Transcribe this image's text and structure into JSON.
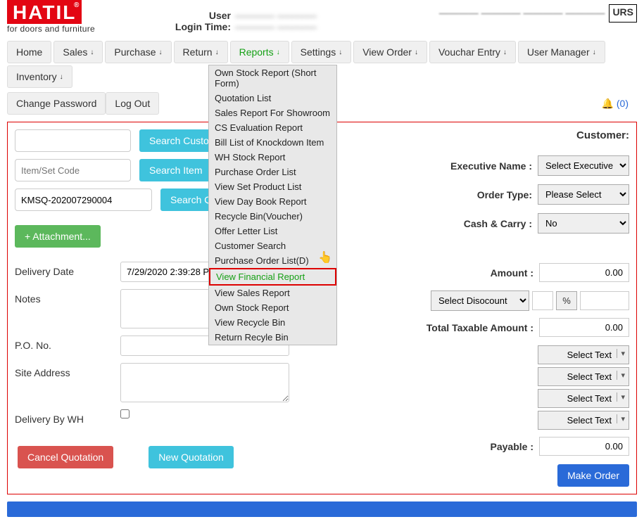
{
  "logo": {
    "brand": "HATIL",
    "tagline": "for doors and furniture"
  },
  "header": {
    "user_label": "User",
    "login_label": "Login Time:",
    "user_val": "———— ————",
    "login_val": "———— ————",
    "script": "———— ———— ———— ————",
    "urs": "URS"
  },
  "nav": {
    "home": "Home",
    "sales": "Sales",
    "purchase": "Purchase",
    "return": "Return",
    "reports": "Reports",
    "settings": "Settings",
    "view_order": "View Order",
    "voucher": "Vouchar Entry",
    "user_mgr": "User Manager",
    "inventory": "Inventory",
    "change_pw": "Change Password",
    "logout": "Log Out",
    "notif_count": "(0)"
  },
  "dropdown": [
    "Own Stock Report (Short Form)",
    "Quotation List",
    "Sales Report For Showroom",
    "CS Evaluation Report",
    "Bill List of Knockdown Item",
    "WH Stock Report",
    "Purchase Order List",
    "View Set Product List",
    "View Day Book Report",
    "Recycle Bin(Voucher)",
    "Offer Letter List",
    "Customer Search",
    "Purchase Order List(D)",
    "View Financial Report",
    "View Sales Report",
    "Own Stock Report",
    "View Recycle Bin",
    "Return Recyle Bin"
  ],
  "highlighted_index": 13,
  "search": {
    "placeholder_itemset": "Item/Set Code",
    "quotation_value": "KMSQ-202007290004",
    "btn_customer": "Search Customer",
    "btn_item": "Search Item",
    "btn_quotation": "Search Quotation"
  },
  "buttons": {
    "attachment": "+  Attachment...",
    "cancel": "Cancel Quotation",
    "new": "New Quotation",
    "make": "Make Order"
  },
  "form": {
    "delivery_date_label": "Delivery Date",
    "delivery_date_value": "7/29/2020 2:39:28 PM",
    "notes_label": "Notes",
    "po_label": "P.O. No.",
    "site_label": "Site Address",
    "delivery_wh_label": "Delivery By WH"
  },
  "right": {
    "customer_title": "Customer:",
    "exec_label": "Executive Name :",
    "exec_value": "Select Executive",
    "order_type_label": "Order Type:",
    "order_type_value": "Please Select",
    "cash_label": "Cash & Carry :",
    "cash_value": "No",
    "amount_label": "Amount :",
    "amount_value": "0.00",
    "discount_value": "Select Disocount",
    "percent": "%",
    "taxable_label": "Total Taxable Amount :",
    "taxable_value": "0.00",
    "select_text": "Select Text",
    "payable_label": "Payable :",
    "payable_value": "0.00"
  }
}
